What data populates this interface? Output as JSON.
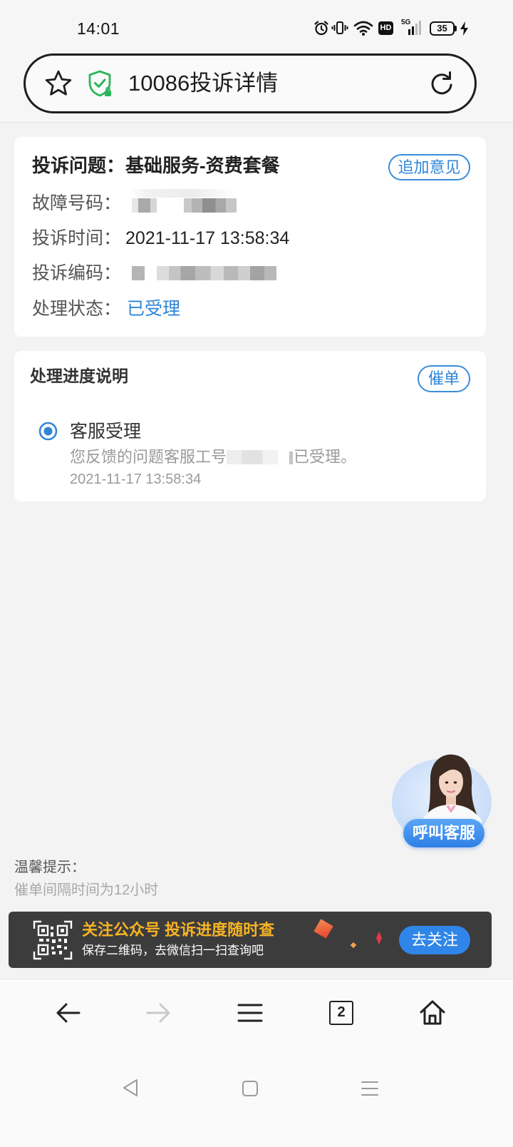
{
  "status_bar": {
    "time": "14:01",
    "hd_badge": "HD",
    "network": "5G",
    "battery": "35",
    "icons": [
      "alarm-icon",
      "vibrate-icon",
      "wifi-icon",
      "hd-badge",
      "signal-icon",
      "battery-icon",
      "charging-icon"
    ]
  },
  "address_bar": {
    "title": "10086投诉详情",
    "icons": {
      "bookmark": "star-icon",
      "security": "shield-check-icon",
      "reload": "refresh-icon"
    }
  },
  "complaint_card": {
    "issue_label": "投诉问题：",
    "issue_value": "基础服务-资费套餐",
    "add_comment_button": "追加意见",
    "fault_number_label": "故障号码：",
    "complaint_time_label": "投诉时间：",
    "complaint_time_value": "2021-11-17 13:58:34",
    "complaint_code_label": "投诉编码：",
    "status_label": "处理状态：",
    "status_value": "已受理"
  },
  "progress_card": {
    "title": "处理进度说明",
    "urge_button": "催单",
    "steps": [
      {
        "title": "客服受理",
        "desc_prefix": "您反馈的问题客服工号",
        "desc_suffix": "已受理。",
        "time": "2021-11-17 13:58:34"
      }
    ]
  },
  "floating_service": {
    "label": "呼叫客服"
  },
  "tips": {
    "title": "温馨提示：",
    "text": "催单间隔时间为12小时"
  },
  "banner": {
    "headline": "关注公众号 投诉进度随时查",
    "subtext": "保存二维码，去微信扫一扫查询吧",
    "button": "去关注",
    "icon": "qr-code-icon"
  },
  "browser_nav": {
    "tab_count": "2",
    "items": [
      "back-icon",
      "forward-icon",
      "menu-icon",
      "tabs-icon",
      "home-icon"
    ]
  },
  "system_nav": {
    "items": [
      "nav-back-icon",
      "nav-home-icon",
      "nav-recents-icon"
    ]
  },
  "colors": {
    "accent": "#2f86d8",
    "secure_green": "#2bb55b",
    "banner_bg": "#3c3c3c",
    "banner_headline": "#f6b325",
    "page_bg": "#f3f3f3"
  }
}
